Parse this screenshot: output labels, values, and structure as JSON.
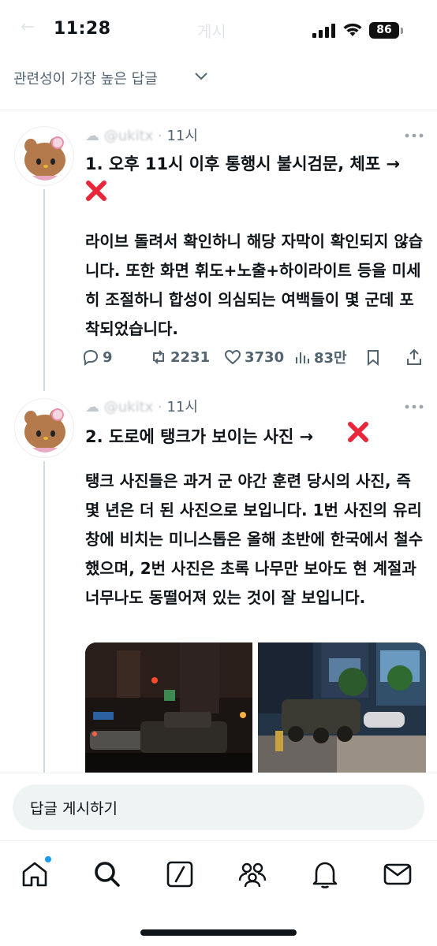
{
  "status_bar": {
    "time": "11:28",
    "faded_title": "게시",
    "battery": "86"
  },
  "sort": {
    "label": "관련성이 가장 높은 답글"
  },
  "tweets": [
    {
      "handle": "@ukitx",
      "time": "11시",
      "headline": "1. 오후 11시 이후 통행시 불시검문, 체포 →",
      "body": "라이브 돌려서 확인하니 해당 자막이 확인되지 않습니다. 또한 화면 휘도+노출+하이라이트 등을 미세히 조절하니 합성이 의심되는 여백들이 몇 군데 포착되었습니다.",
      "replies": "9",
      "reposts": "2231",
      "likes": "3730",
      "views": "83만"
    },
    {
      "handle": "@ukitx",
      "time": "11시",
      "headline": "2. 도로에 탱크가 보이는 사진 →",
      "body": "탱크 사진들은 과거 군 야간 훈련 당시의 사진, 즉 몇 년은 더 된 사진으로 보입니다. 1번 사진의 유리창에 비치는 미니스톱은 올해 초반에 한국에서 철수했으며, 2번 사진은 초록 나무만 보아도 현 계절과 너무나도 동떨어져 있는 것이 잘 보입니다."
    }
  ],
  "reply_bar": {
    "placeholder": "답글 게시하기"
  },
  "icons": {
    "x_mark": "cross-mark-icon",
    "tabs": [
      "home-icon",
      "search-icon",
      "grok-icon",
      "communities-icon",
      "notifications-icon",
      "messages-icon"
    ]
  },
  "colors": {
    "x_mark": "#e8283a",
    "text_secondary": "#536471",
    "accent": "#1d9bf0"
  }
}
